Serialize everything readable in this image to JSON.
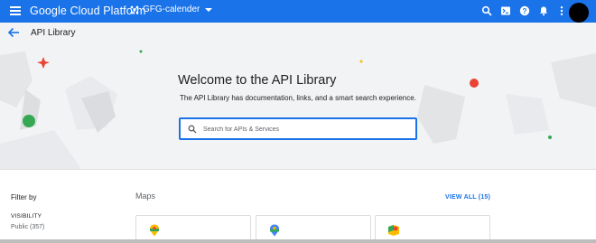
{
  "topbar": {
    "brand": "Google Cloud Platform",
    "project": "GFG-calender"
  },
  "subbar": {
    "title": "API Library"
  },
  "hero": {
    "title": "Welcome to the API Library",
    "subtitle": "The API Library has documentation, links, and a smart search experience."
  },
  "search": {
    "placeholder": "Search for APIs & Services"
  },
  "filter": {
    "title": "Filter by",
    "visibility_title": "VISIBILITY",
    "visibility_item": "Public (357)"
  },
  "section": {
    "title": "Maps",
    "view_all": "VIEW ALL (15)"
  },
  "colors": {
    "primary": "#1a73e8",
    "hero_bg": "#f1f3f4"
  }
}
